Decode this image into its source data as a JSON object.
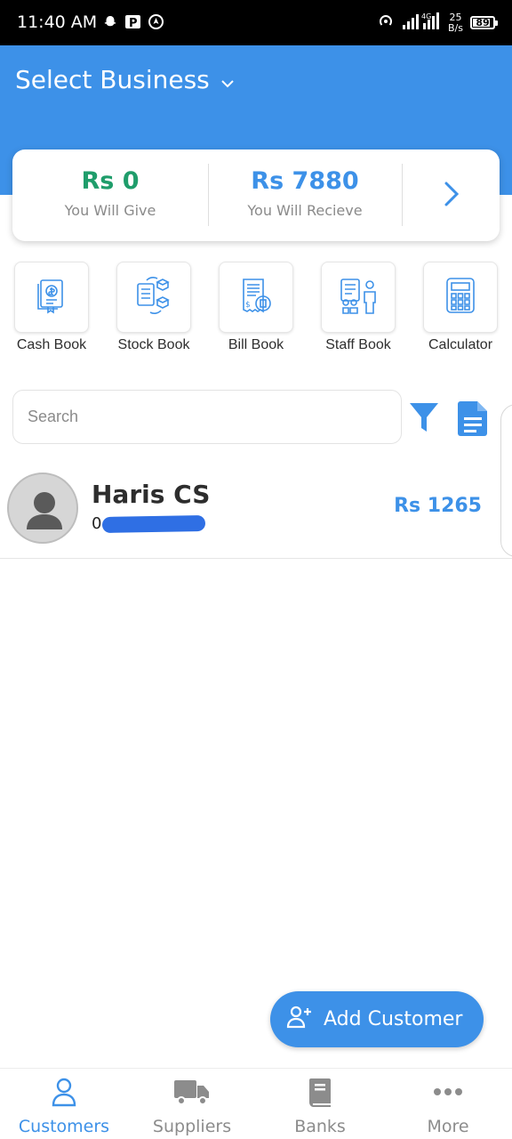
{
  "status_bar": {
    "time": "11:40 AM",
    "network": "4G",
    "speed_value": "25",
    "speed_unit": "B/s",
    "battery": "89"
  },
  "header": {
    "business_selector": "Select Business",
    "bg_color": "#3d91e8"
  },
  "summary": {
    "give_amount": "Rs 0",
    "give_label": "You Will Give",
    "receive_amount": "Rs 7880",
    "receive_label": "You Will Recieve",
    "give_color": "#1f9d6b",
    "receive_color": "#3d91e8"
  },
  "tools": [
    {
      "label": "Cash Book",
      "icon": "cash-book-icon"
    },
    {
      "label": "Stock Book",
      "icon": "stock-book-icon"
    },
    {
      "label": "Bill Book",
      "icon": "bill-book-icon"
    },
    {
      "label": "Staff Book",
      "icon": "staff-book-icon"
    },
    {
      "label": "Calculator",
      "icon": "calculator-icon"
    }
  ],
  "search": {
    "placeholder": "Search"
  },
  "customers": [
    {
      "name": "Haris CS",
      "phone": "0",
      "amount": "Rs 1265"
    }
  ],
  "fab": {
    "label": "Add Customer"
  },
  "bottom_nav": {
    "items": [
      {
        "label": "Customers",
        "icon": "person-icon",
        "active": true
      },
      {
        "label": "Suppliers",
        "icon": "truck-icon",
        "active": false
      },
      {
        "label": "Banks",
        "icon": "book-icon",
        "active": false
      },
      {
        "label": "More",
        "icon": "more-dots-icon",
        "active": false
      }
    ]
  }
}
